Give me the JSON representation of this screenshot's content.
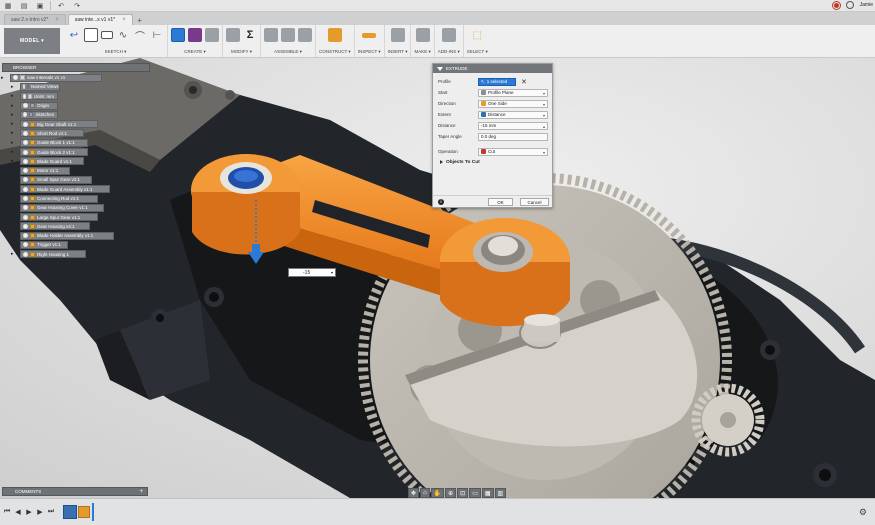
{
  "topbar": {
    "user": "Jamie",
    "icons": [
      "grid-icon",
      "file-icon",
      "save-icon",
      "undo-icon",
      "redo-icon"
    ]
  },
  "tabs": [
    {
      "label": "saw 2.x-Intro v2*",
      "active": false
    },
    {
      "label": "saw inte...s v1 v1*",
      "active": true
    }
  ],
  "toolbar": {
    "mode": "MODEL ▾",
    "groups": [
      {
        "label": "SKETCH ▾"
      },
      {
        "label": "CREATE ▾"
      },
      {
        "label": "MODIFY ▾"
      },
      {
        "label": "ASSEMBLE ▾"
      },
      {
        "label": "CONSTRUCT ▾"
      },
      {
        "label": "INSPECT ▾"
      },
      {
        "label": "INSERT ▾"
      },
      {
        "label": "MAKE ▾"
      },
      {
        "label": "ADD-INS ▾"
      },
      {
        "label": "SELECT ▾"
      }
    ],
    "sigma": "Σ"
  },
  "browser": {
    "title": "BROWSER",
    "items": [
      {
        "label": "saw internals v1 v1",
        "icon": "doc"
      },
      {
        "label": "Named Views",
        "icon": "fold"
      },
      {
        "label": "Units: mm",
        "icon": "doc"
      },
      {
        "label": "Origin",
        "icon": "fold"
      },
      {
        "label": "Sketches",
        "icon": "fold"
      },
      {
        "label": "Big Gear Shaft v1:1",
        "icon": "comp"
      },
      {
        "label": "Short Rod v1:1",
        "icon": "comp"
      },
      {
        "label": "Guide Block 1 v1:1",
        "icon": "comp"
      },
      {
        "label": "Guide Block 2 v1:1",
        "icon": "comp"
      },
      {
        "label": "Blade Guard v1:1",
        "icon": "comp"
      },
      {
        "label": "Motor v1:1",
        "icon": "comp"
      },
      {
        "label": "Small Spur Gear v1:1",
        "icon": "comp"
      },
      {
        "label": "Blade Guard Assembly v1:1",
        "icon": "comp"
      },
      {
        "label": "Connecting Rod v1:1",
        "icon": "comp"
      },
      {
        "label": "Gear Housing Cover v1:1",
        "icon": "comp"
      },
      {
        "label": "Large Spur Gear v1:1",
        "icon": "comp"
      },
      {
        "label": "Gear Housing v4:1",
        "icon": "comp"
      },
      {
        "label": "Blade Holder Assembly v1:1",
        "icon": "comp"
      },
      {
        "label": "Trigger v1:1",
        "icon": "comp"
      },
      {
        "label": "Right Housing 1",
        "icon": "comp"
      }
    ]
  },
  "extrude": {
    "title": "EXTRUDE",
    "profile_label": "Profile",
    "profile_value": "1 selected",
    "clear": "✕",
    "start_label": "Start",
    "start_value": "Profile Plane",
    "direction_label": "Direction",
    "direction_value": "One Side",
    "extent_label": "Extent",
    "extent_value": "Distance",
    "distance_label": "Distance",
    "distance_value": "-15 mm",
    "taper_label": "Taper Angle",
    "taper_value": "0.0 deg",
    "operation_label": "Operation",
    "operation_value": "Cut",
    "objects_label": "Objects To Cut",
    "ok": "OK",
    "cancel": "Cancel",
    "info": "i"
  },
  "dimension": {
    "value": "-15"
  },
  "comments": {
    "label": "COMMENTS",
    "plus": "+"
  },
  "timeline": {
    "controls": [
      "⏮",
      "◀",
      "▶",
      "▶",
      "⏭"
    ]
  },
  "colors": {
    "accent": "#2b7bd6",
    "connecting_rod": "#f08a24",
    "housing": "#1f2328"
  }
}
